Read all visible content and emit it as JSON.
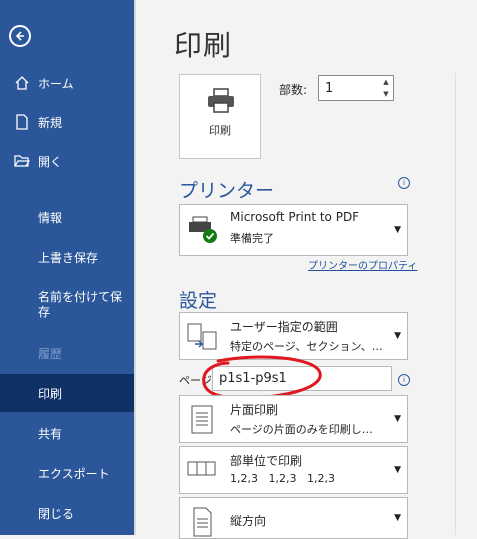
{
  "sidebar": {
    "back_label": "",
    "items": [
      {
        "label": "ホーム",
        "icon": "home-icon"
      },
      {
        "label": "新規",
        "icon": "new-file-icon"
      },
      {
        "label": "開く",
        "icon": "open-folder-icon"
      }
    ],
    "info": "情報",
    "save": "上書き保存",
    "save_as": "名前を付けて保存",
    "history": "履歴",
    "print": "印刷",
    "share": "共有",
    "export": "エクスポート",
    "close": "閉じる"
  },
  "main": {
    "title": "印刷",
    "print_button": "印刷",
    "copies_label": "部数:",
    "copies_value": "1",
    "printer_heading": "プリンター",
    "printer_name": "Microsoft Print to PDF",
    "printer_status": "準備完了",
    "printer_properties": "プリンターのプロパティ",
    "settings_heading": "設定",
    "range_title": "ユーザー指定の範囲",
    "range_desc": "特定のページ、セクション、…",
    "pages_label": "ページ:",
    "pages_value": "p1s1-p9s1",
    "sides_title": "片面印刷",
    "sides_desc": "ページの片面のみを印刷し…",
    "collate_title": "部単位で印刷",
    "collate_desc": "1,2,3   1,2,3   1,2,3",
    "orientation_title": "縦方向"
  },
  "colors": {
    "sidebar": "#2b579a",
    "active": "#0f3166",
    "annotation": "#e0171f"
  }
}
